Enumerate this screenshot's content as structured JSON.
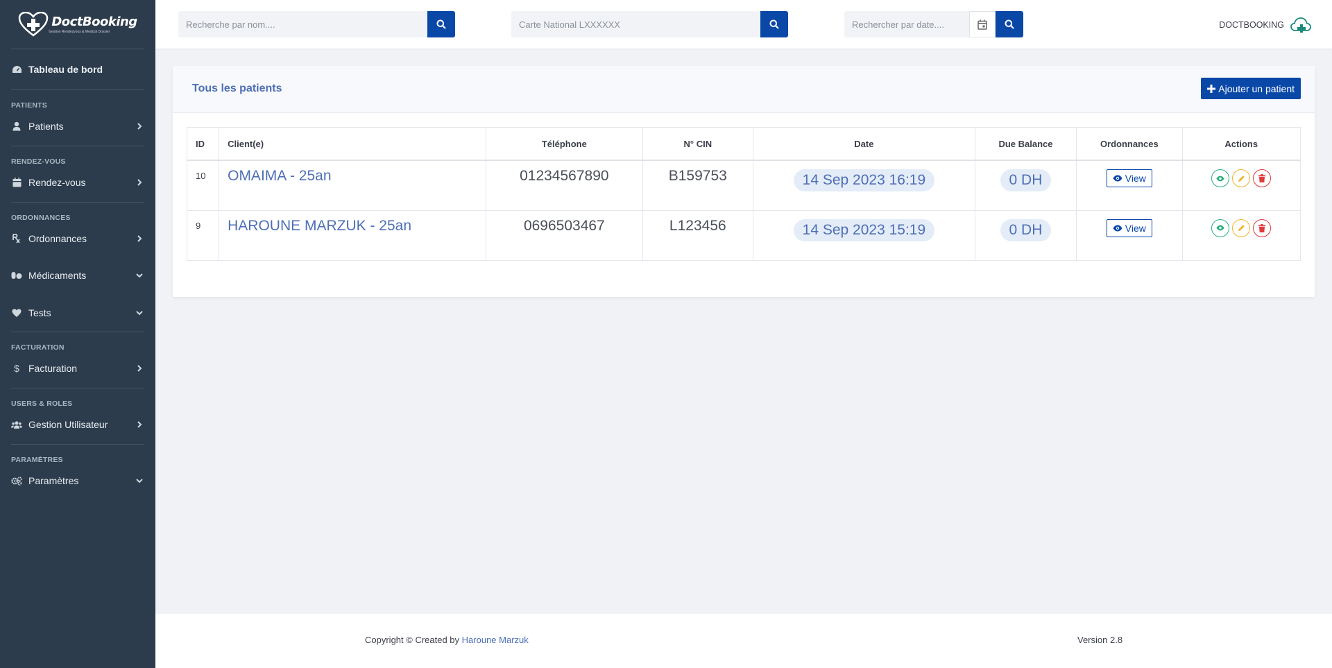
{
  "app": {
    "logo_text": "DoctBooking",
    "logo_sub": "Gestion Rendezvous & Medical Dossier"
  },
  "sidebar": {
    "dashboard": "Tableau de bord",
    "sections": [
      {
        "heading": "PATIENTS",
        "item": "Patients",
        "chevron": "right"
      },
      {
        "heading": "RENDEZ-VOUS",
        "item": "Rendez-vous",
        "chevron": "right"
      },
      {
        "heading": "ORDONNANCES",
        "item": "Ordonnances",
        "chevron": "right"
      }
    ],
    "extra_items": [
      {
        "label": "Médicaments",
        "chevron": "down"
      },
      {
        "label": "Tests",
        "chevron": "down"
      }
    ],
    "sections2": [
      {
        "heading": "FACTURATION",
        "item": "Facturation",
        "chevron": "right"
      },
      {
        "heading": "USERS & ROLES",
        "item": "Gestion Utilisateur",
        "chevron": "right"
      },
      {
        "heading": "PARAMÈTRES",
        "item": "Paramètres",
        "chevron": "down"
      }
    ]
  },
  "topbar": {
    "search_name_placeholder": "Recherche par nom....",
    "search_cin_placeholder": "Carte National LXXXXXX",
    "search_date_placeholder": "Rechercher par date....",
    "user_name": "DOCTBOOKING"
  },
  "card": {
    "title": "Tous les patients",
    "add_button": "Ajouter un patient"
  },
  "table": {
    "headers": [
      "ID",
      "Client(e)",
      "Téléphone",
      "N° CIN",
      "Date",
      "Due Balance",
      "Ordonnances",
      "Actions"
    ],
    "rows": [
      {
        "id": "10",
        "client": "OMAIMA - 25an",
        "phone": "01234567890",
        "cin": "B159753",
        "date": "14 Sep 2023 16:19",
        "balance": "0 DH",
        "view": "View"
      },
      {
        "id": "9",
        "client": "HAROUNE MARZUK - 25an",
        "phone": "0696503467",
        "cin": "L123456",
        "date": "14 Sep 2023 15:19",
        "balance": "0 DH",
        "view": "View"
      }
    ]
  },
  "footer": {
    "copyright": "Copyright © Created by",
    "author": "Haroune Marzuk",
    "version": "Version 2.8"
  },
  "colors": {
    "sidebar": "#2d3c4c",
    "primary": "#0a48a8",
    "link": "#4e6fb5"
  }
}
